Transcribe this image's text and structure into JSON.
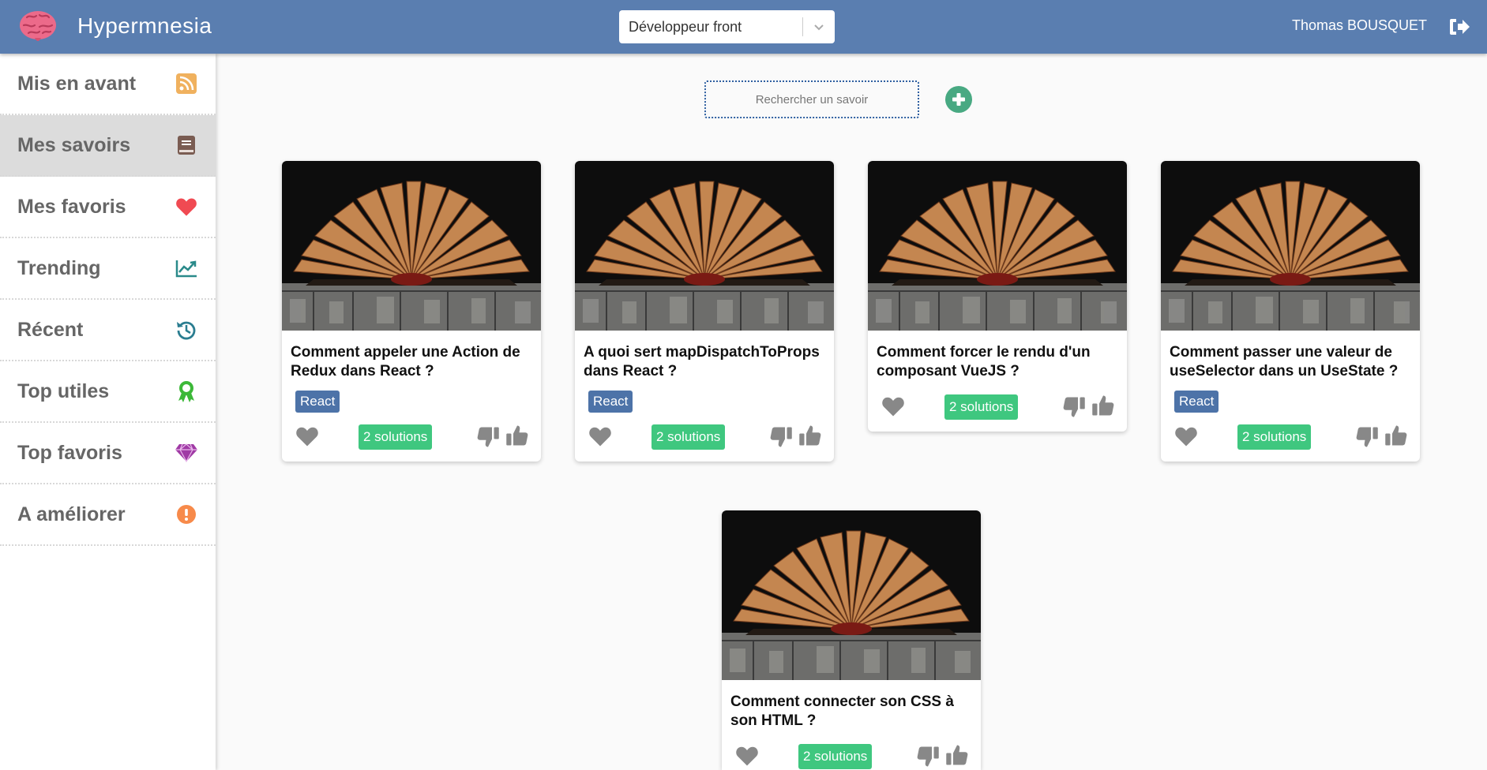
{
  "app": {
    "title": "Hypermnesia"
  },
  "header": {
    "role_selected": "Développeur front",
    "user_name": "Thomas BOUSQUET"
  },
  "sidebar": {
    "items": [
      {
        "label": "Mis en avant",
        "icon": "rss-icon",
        "color": "#f0b15e"
      },
      {
        "label": "Mes savoirs",
        "icon": "book-icon",
        "color": "#7a5c52",
        "active": true
      },
      {
        "label": "Mes favoris",
        "icon": "heart-icon",
        "color": "#f04a52"
      },
      {
        "label": "Trending",
        "icon": "chart-line-icon",
        "color": "#2a8a8a"
      },
      {
        "label": "Récent",
        "icon": "history-icon",
        "color": "#2a7d90"
      },
      {
        "label": "Top utiles",
        "icon": "award-icon",
        "color": "#3cb838"
      },
      {
        "label": "Top favoris",
        "icon": "gem-icon",
        "color": "#a03aa5"
      },
      {
        "label": "A améliorer",
        "icon": "exclamation-circle-icon",
        "color": "#f78a4a"
      }
    ]
  },
  "search": {
    "placeholder": "Rechercher un savoir"
  },
  "colors": {
    "header": "#5a7eb0",
    "tag": "#4d73a8",
    "solutions_badge": "#3fc77f",
    "add_button": "#48a982"
  },
  "cards": [
    {
      "title": "Comment appeler une Action de Redux dans React ?",
      "tag": "React",
      "solutions": "2 solutions"
    },
    {
      "title": "A quoi sert mapDispatchToProps dans React ?",
      "tag": "React",
      "solutions": "2 solutions"
    },
    {
      "title": "Comment forcer le rendu d'un composant VueJS ?",
      "tag": "",
      "solutions": "2 solutions"
    },
    {
      "title": "Comment passer une valeur de useSelector dans un UseState ?",
      "tag": "React",
      "solutions": "2 solutions"
    },
    {
      "title": "Comment connecter son CSS à son HTML ?",
      "tag": "",
      "solutions": "2 solutions"
    }
  ]
}
